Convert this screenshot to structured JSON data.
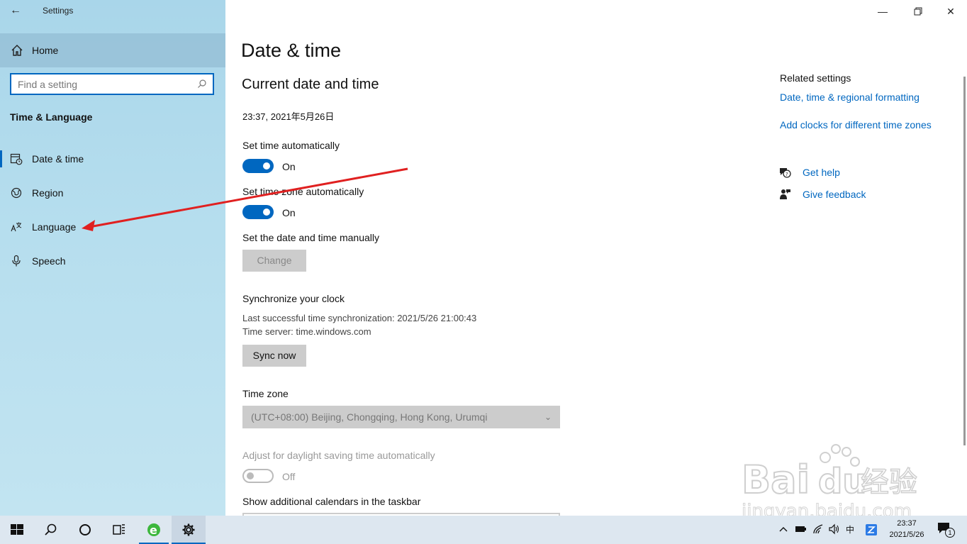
{
  "app": {
    "title": "Settings"
  },
  "sidebar": {
    "home_label": "Home",
    "search_placeholder": "Find a setting",
    "section_title": "Time & Language",
    "items": [
      {
        "label": "Date & time",
        "icon": "calendar-clock-icon"
      },
      {
        "label": "Region",
        "icon": "globe-icon"
      },
      {
        "label": "Language",
        "icon": "language-icon"
      },
      {
        "label": "Speech",
        "icon": "microphone-icon"
      }
    ]
  },
  "main": {
    "page_title": "Date & time",
    "section_title": "Current date and time",
    "current_datetime": "23:37, 2021年5月26日",
    "set_time_auto": {
      "label": "Set time automatically",
      "state": "On"
    },
    "set_tz_auto": {
      "label": "Set time zone automatically",
      "state": "On"
    },
    "manual": {
      "label": "Set the date and time manually",
      "button": "Change"
    },
    "sync": {
      "title": "Synchronize your clock",
      "last_sync": "Last successful time synchronization: 2021/5/26 21:00:43",
      "server": "Time server: time.windows.com",
      "button": "Sync now"
    },
    "time_zone": {
      "label": "Time zone",
      "value": "(UTC+08:00) Beijing, Chongqing, Hong Kong, Urumqi"
    },
    "dst": {
      "label": "Adjust for daylight saving time automatically",
      "state": "Off"
    },
    "calendars": {
      "label": "Show additional calendars in the taskbar"
    }
  },
  "related": {
    "title": "Related settings",
    "links": [
      "Date, time & regional formatting",
      "Add clocks for different time zones"
    ],
    "help": "Get help",
    "feedback": "Give feedback"
  },
  "watermark": {
    "logo": "Baidu经验",
    "url": "jingyan.baidu.com"
  },
  "taskbar": {
    "time": "23:37",
    "date": "2021/5/26",
    "ime": "中",
    "notifications": "1"
  },
  "colors": {
    "accent": "#0067c0",
    "annotation": "#e02020"
  }
}
